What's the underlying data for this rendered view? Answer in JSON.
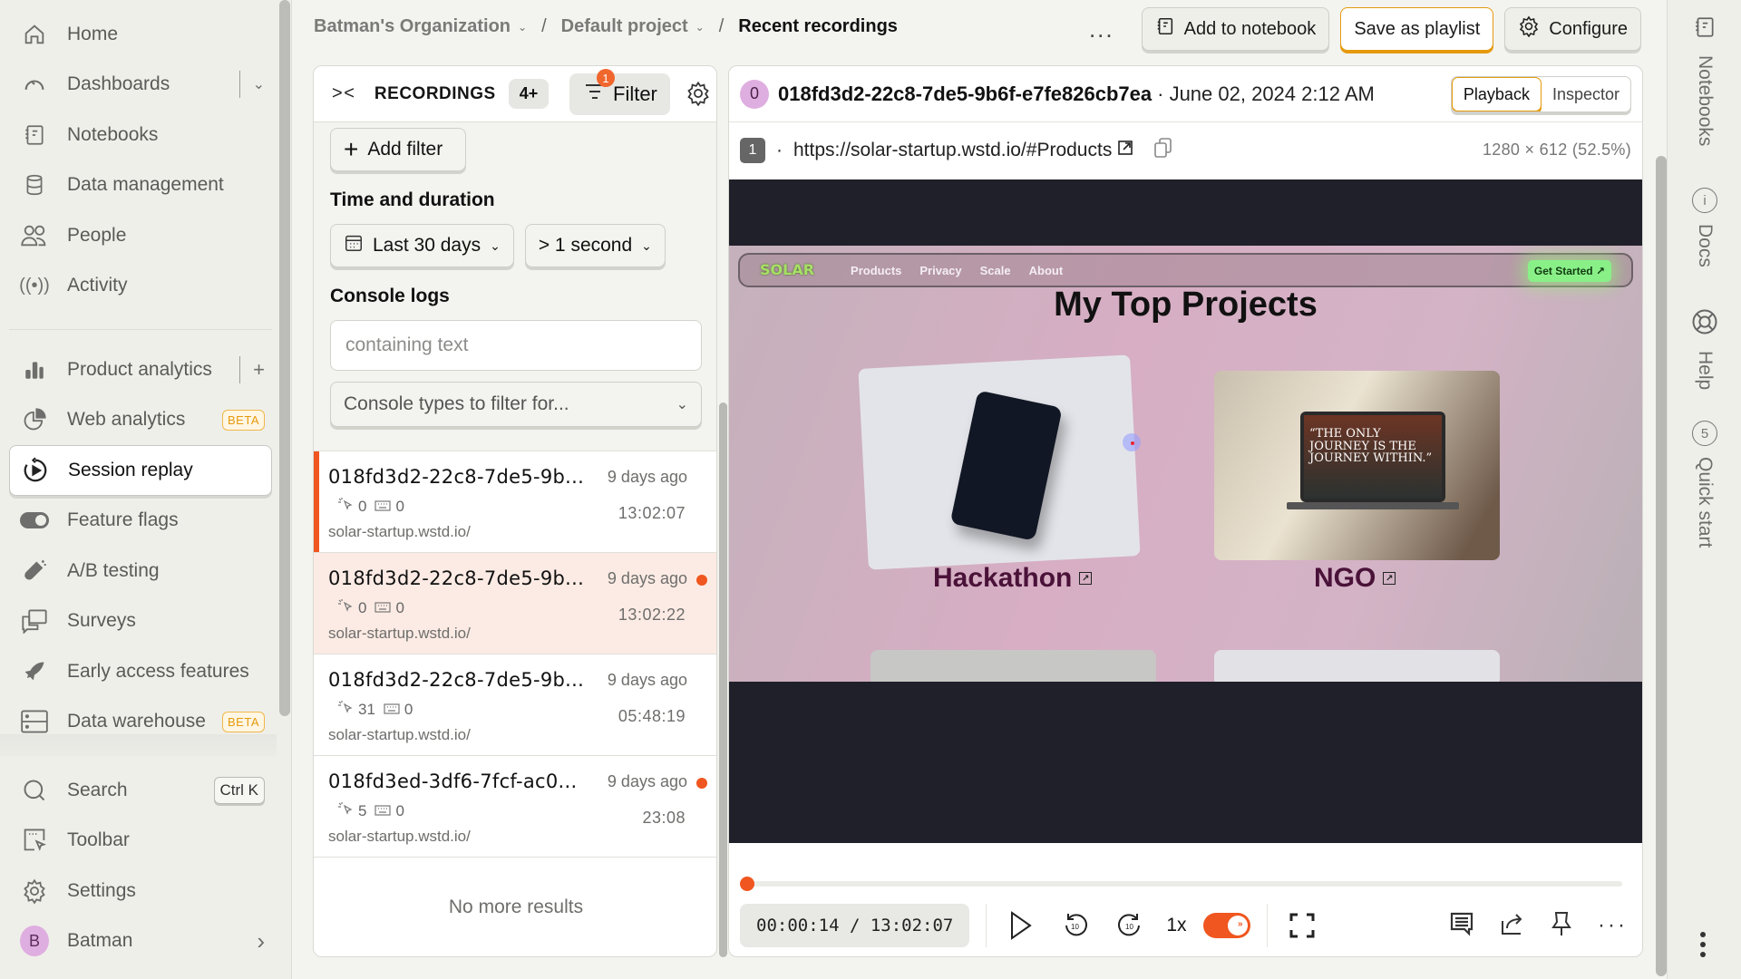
{
  "nav": {
    "items": [
      {
        "label": "Home",
        "icon": "home-icon"
      },
      {
        "label": "Dashboards",
        "icon": "gauge-icon",
        "aside": "chevron-down"
      },
      {
        "label": "Notebooks",
        "icon": "notebook-icon"
      },
      {
        "label": "Data management",
        "icon": "database-icon"
      },
      {
        "label": "People",
        "icon": "people-icon"
      },
      {
        "label": "Activity",
        "icon": "broadcast-icon"
      }
    ],
    "products": [
      {
        "label": "Product analytics",
        "icon": "bar-chart-icon",
        "aside": "plus"
      },
      {
        "label": "Web analytics",
        "icon": "pie-chart-icon",
        "badge": "BETA"
      },
      {
        "label": "Session replay",
        "icon": "replay-icon",
        "active": true
      },
      {
        "label": "Feature flags",
        "icon": "toggle-icon"
      },
      {
        "label": "A/B testing",
        "icon": "flask-icon"
      },
      {
        "label": "Surveys",
        "icon": "chat-bubbles-icon"
      },
      {
        "label": "Early access features",
        "icon": "rocket-icon"
      },
      {
        "label": "Data warehouse",
        "icon": "server-icon",
        "badge": "BETA"
      }
    ],
    "bottom": {
      "search": "Search",
      "search_shortcut": "Ctrl K",
      "toolbar": "Toolbar",
      "settings": "Settings",
      "user_initial": "B",
      "user_name": "Batman"
    }
  },
  "breadcrumb": {
    "org": "Batman's Organization",
    "project": "Default project",
    "page": "Recent recordings"
  },
  "top_actions": {
    "more": "...",
    "add_to_notebook": "Add to notebook",
    "save_as_playlist": "Save as playlist",
    "configure": "Configure"
  },
  "recordings": {
    "title": "RECORDINGS",
    "count": "4+",
    "filter_label": "Filter",
    "filter_count": "1",
    "add_filter": "Add filter",
    "time_section": "Time and duration",
    "date_range": "Last 30 days",
    "duration": "> 1 second",
    "console_section": "Console logs",
    "console_placeholder": "containing text",
    "console_types_placeholder": "Console types to filter for...",
    "items": [
      {
        "id": "018fd3d2-22c8-7de5-9b...",
        "ago": "9 days ago",
        "clicks": "0",
        "keys": "0",
        "duration": "13:02:07",
        "url": "solar-startup.wstd.io/",
        "selected": true,
        "unwatched": false
      },
      {
        "id": "018fd3d2-22c8-7de5-9b...",
        "ago": "9 days ago",
        "clicks": "0",
        "keys": "0",
        "duration": "13:02:22",
        "url": "solar-startup.wstd.io/",
        "selected": false,
        "unwatched": true
      },
      {
        "id": "018fd3d2-22c8-7de5-9b...",
        "ago": "9 days ago",
        "clicks": "31",
        "keys": "0",
        "duration": "05:48:19",
        "url": "solar-startup.wstd.io/",
        "selected": false,
        "unwatched": false
      },
      {
        "id": "018fd3ed-3df6-7fcf-ac0...",
        "ago": "9 days ago",
        "clicks": "5",
        "keys": "0",
        "duration": "23:08",
        "url": "solar-startup.wstd.io/",
        "selected": false,
        "unwatched": true
      }
    ],
    "no_more": "No more results"
  },
  "player": {
    "person_initial": "0",
    "session_id": "018fd3d2-22c8-7de5-9b6f-e7fe826cb7ea",
    "date": "· June 02, 2024 2:12 AM",
    "tabs": [
      "Playback",
      "Inspector"
    ],
    "active_tab": "Playback",
    "url_index": "1",
    "url": "https://solar-startup.wstd.io/#Products",
    "resolution": "1280 × 612 (52.5%)",
    "time_current": "00:00:14",
    "time_total": "13:02:07",
    "time_display": "00:00:14 / 13:02:07",
    "progress_fraction": 0.0003,
    "speed": "1x",
    "skip_inactivity": true,
    "accent": "#f0561f"
  },
  "site_preview": {
    "logo": "SOLAR",
    "links": [
      "Products",
      "Privacy",
      "Scale",
      "About"
    ],
    "cta": "Get Started ↗",
    "heading": "My Top Projects",
    "cards": [
      {
        "label": "Hackathon"
      },
      {
        "label": "NGO",
        "quote": "“THE ONLY JOURNEY IS THE JOURNEY WITHIN.”"
      }
    ]
  },
  "right_sidebar": {
    "notebooks": "Notebooks",
    "docs": "Docs",
    "help": "Help",
    "quick_start": "Quick start",
    "quick_start_count": "5"
  }
}
